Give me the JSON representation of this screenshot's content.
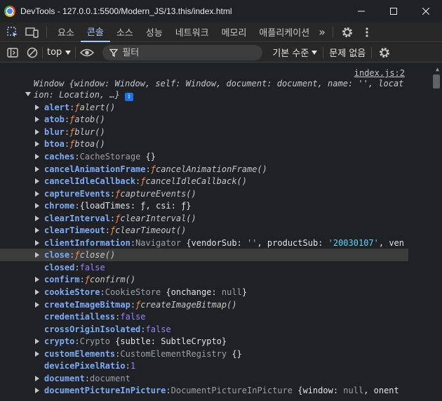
{
  "titlebar": {
    "title": "DevTools - 127.0.0.1:5500/Modern_JS/13.this/index.html",
    "minimize": "–",
    "maximize": "☐",
    "close": "✕"
  },
  "tabs": {
    "items": [
      "요소",
      "콘솔",
      "소스",
      "성능",
      "네트워크",
      "메모리",
      "애플리케이션"
    ],
    "active": "콘솔",
    "more": "»"
  },
  "toolbar": {
    "context": "top",
    "filter_placeholder": "필터",
    "levels": "기본 수준",
    "issues": "문제 없음"
  },
  "console": {
    "source": "index.js:2",
    "window_summary": "Window {window: Window, self: Window, document: document, name: '', location: Location, …}",
    "info": "i",
    "highlighted": "close",
    "properties": [
      {
        "key": "alert",
        "kind": "fn",
        "value": "alert()",
        "expandable": true
      },
      {
        "key": "atob",
        "kind": "fn",
        "value": "atob()",
        "expandable": true
      },
      {
        "key": "blur",
        "kind": "fn",
        "value": "blur()",
        "expandable": true
      },
      {
        "key": "btoa",
        "kind": "fn",
        "value": "btoa()",
        "expandable": true
      },
      {
        "key": "caches",
        "kind": "obj",
        "value": "CacheStorage {}",
        "expandable": true
      },
      {
        "key": "cancelAnimationFrame",
        "kind": "fn",
        "value": "cancelAnimationFrame()",
        "expandable": true
      },
      {
        "key": "cancelIdleCallback",
        "kind": "fn",
        "value": "cancelIdleCallback()",
        "expandable": true
      },
      {
        "key": "captureEvents",
        "kind": "fn",
        "value": "captureEvents()",
        "expandable": true
      },
      {
        "key": "chrome",
        "kind": "plain",
        "value": "{loadTimes: ƒ, csi: ƒ}",
        "expandable": true
      },
      {
        "key": "clearInterval",
        "kind": "fn",
        "value": "clearInterval()",
        "expandable": true
      },
      {
        "key": "clearTimeout",
        "kind": "fn",
        "value": "clearTimeout()",
        "expandable": true
      },
      {
        "key": "clientInformation",
        "kind": "obj",
        "value": "Navigator {vendorSub: '', productSub: '20030107', ven",
        "expandable": true
      },
      {
        "key": "close",
        "kind": "fn",
        "value": "close()",
        "expandable": true
      },
      {
        "key": "closed",
        "kind": "kw",
        "value": "false",
        "expandable": false
      },
      {
        "key": "confirm",
        "kind": "fn",
        "value": "confirm()",
        "expandable": true
      },
      {
        "key": "cookieStore",
        "kind": "obj",
        "value": "CookieStore {onchange: null}",
        "expandable": true
      },
      {
        "key": "createImageBitmap",
        "kind": "fn",
        "value": "createImageBitmap()",
        "expandable": true
      },
      {
        "key": "credentialless",
        "kind": "kw",
        "value": "false",
        "expandable": false
      },
      {
        "key": "crossOriginIsolated",
        "kind": "kw",
        "value": "false",
        "expandable": false
      },
      {
        "key": "crypto",
        "kind": "obj",
        "value": "Crypto {subtle: SubtleCrypto}",
        "expandable": true
      },
      {
        "key": "customElements",
        "kind": "obj",
        "value": "CustomElementRegistry {}",
        "expandable": true
      },
      {
        "key": "devicePixelRatio",
        "kind": "kw",
        "value": "1",
        "expandable": false
      },
      {
        "key": "document",
        "kind": "obj",
        "value": "document",
        "expandable": true
      },
      {
        "key": "documentPictureInPicture",
        "kind": "obj",
        "value": "DocumentPictureInPicture {window: null, onent",
        "expandable": true
      }
    ]
  },
  "colors": {
    "background": "#202124",
    "accent": "#a8c7fa",
    "key": "#7cacf8",
    "function_symbol": "#f28b54",
    "keyword": "#9980ff",
    "string": "#5cd5fb"
  }
}
